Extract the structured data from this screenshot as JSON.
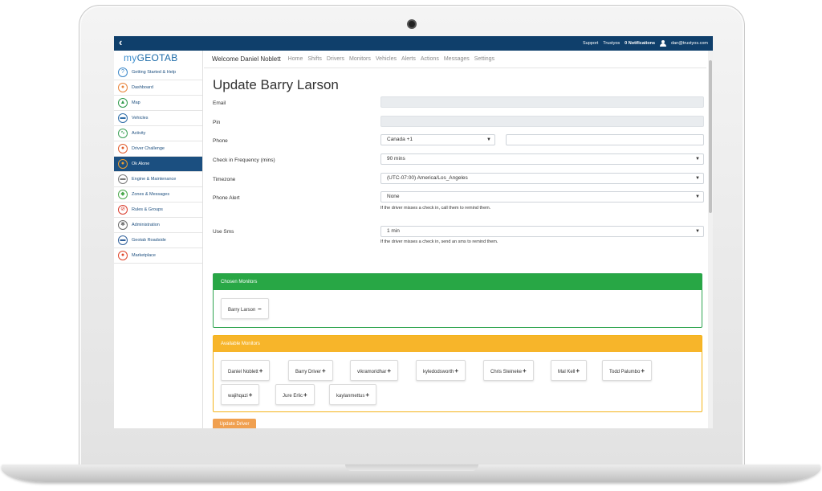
{
  "topbar": {
    "back_icon": "chevron-left-icon",
    "links": [
      "Support",
      "Trustyos"
    ],
    "notifications": "0 Notifications",
    "user_icon": "user-icon",
    "email": "dan@trustyos.com"
  },
  "sidebar": {
    "logo_my": "my",
    "logo_brand": "GEOTAB",
    "items": [
      {
        "label": "Getting Started & Help",
        "icon": "help-icon",
        "color": "#3a86c8",
        "glyph": "?"
      },
      {
        "label": "Dashboard",
        "icon": "dashboard-icon",
        "color": "#e8833a",
        "glyph": "●"
      },
      {
        "label": "Map",
        "icon": "map-icon",
        "color": "#2e9a4a",
        "glyph": "▲"
      },
      {
        "label": "Vehicles",
        "icon": "truck-icon",
        "color": "#2f6da8",
        "glyph": "▬"
      },
      {
        "label": "Activity",
        "icon": "activity-icon",
        "color": "#3aa055",
        "glyph": "∿"
      },
      {
        "label": "Driver Challenge",
        "icon": "driver-challenge-icon",
        "color": "#e05a2a",
        "glyph": "●"
      },
      {
        "label": "Ok Alone",
        "icon": "ok-alone-icon",
        "color": "#f0a030",
        "glyph": "●",
        "active": true
      },
      {
        "label": "Engine & Maintenance",
        "icon": "engine-icon",
        "color": "#7a7a7a",
        "glyph": "▬"
      },
      {
        "label": "Zones & Messages",
        "icon": "zones-icon",
        "color": "#49a84a",
        "glyph": "◆"
      },
      {
        "label": "Rules & Groups",
        "icon": "rules-icon",
        "color": "#d93a2a",
        "glyph": "⊘"
      },
      {
        "label": "Administration",
        "icon": "gear-icon",
        "color": "#6a6a6a",
        "glyph": "✱"
      },
      {
        "label": "Geotab Roadside",
        "icon": "roadside-icon",
        "color": "#2f5f9a",
        "glyph": "▬"
      },
      {
        "label": "Marketplace",
        "icon": "marketplace-icon",
        "color": "#e0452a",
        "glyph": "●"
      }
    ]
  },
  "subnav": {
    "welcome": "Welcome Daniel Noblett",
    "links": [
      "Home",
      "Shifts",
      "Drivers",
      "Monitors",
      "Vehicles",
      "Alerts",
      "Actions",
      "Messages",
      "Settings"
    ]
  },
  "form": {
    "title": "Update Barry Larson",
    "email_label": "Email",
    "email_value": "",
    "pin_label": "Pin",
    "pin_value": "",
    "phone_label": "Phone",
    "phone_country": "Canada +1",
    "phone_number": "",
    "checkin_label": "Check in Frequency (mins)",
    "checkin_value": "90 mins",
    "timezone_label": "Timezone",
    "timezone_value": "(UTC-07:00) America/Los_Angeles",
    "phone_alert_label": "Phone Alert",
    "phone_alert_value": "None",
    "phone_alert_help": "If the driver misses a check in, call them to remind them.",
    "sms_label": "Use Sms",
    "sms_value": "1 min",
    "sms_help": "If the driver misses a check in, send an sms to remind them."
  },
  "chosen_monitors": {
    "header": "Chosen Monitors",
    "items": [
      "Barry Larson"
    ],
    "remove_symbol": "−"
  },
  "available_monitors": {
    "header": "Available Monitors",
    "items": [
      "Daniel Noblett",
      "Barry Driver",
      "vikramoridhar",
      "kyledodsworth",
      "Chris Steineke",
      "Mal Kell",
      "Todd Palumbo",
      "wajihqazi",
      "Jure Erlic",
      "kaylanmettus"
    ],
    "add_symbol": "+"
  },
  "update_button": "Update Driver",
  "colors": {
    "topbar": "#0f3f6b",
    "active_nav": "#1b4f80",
    "chosen_accent": "#28a745",
    "available_accent": "#f7b52a",
    "button": "#f0a050"
  }
}
